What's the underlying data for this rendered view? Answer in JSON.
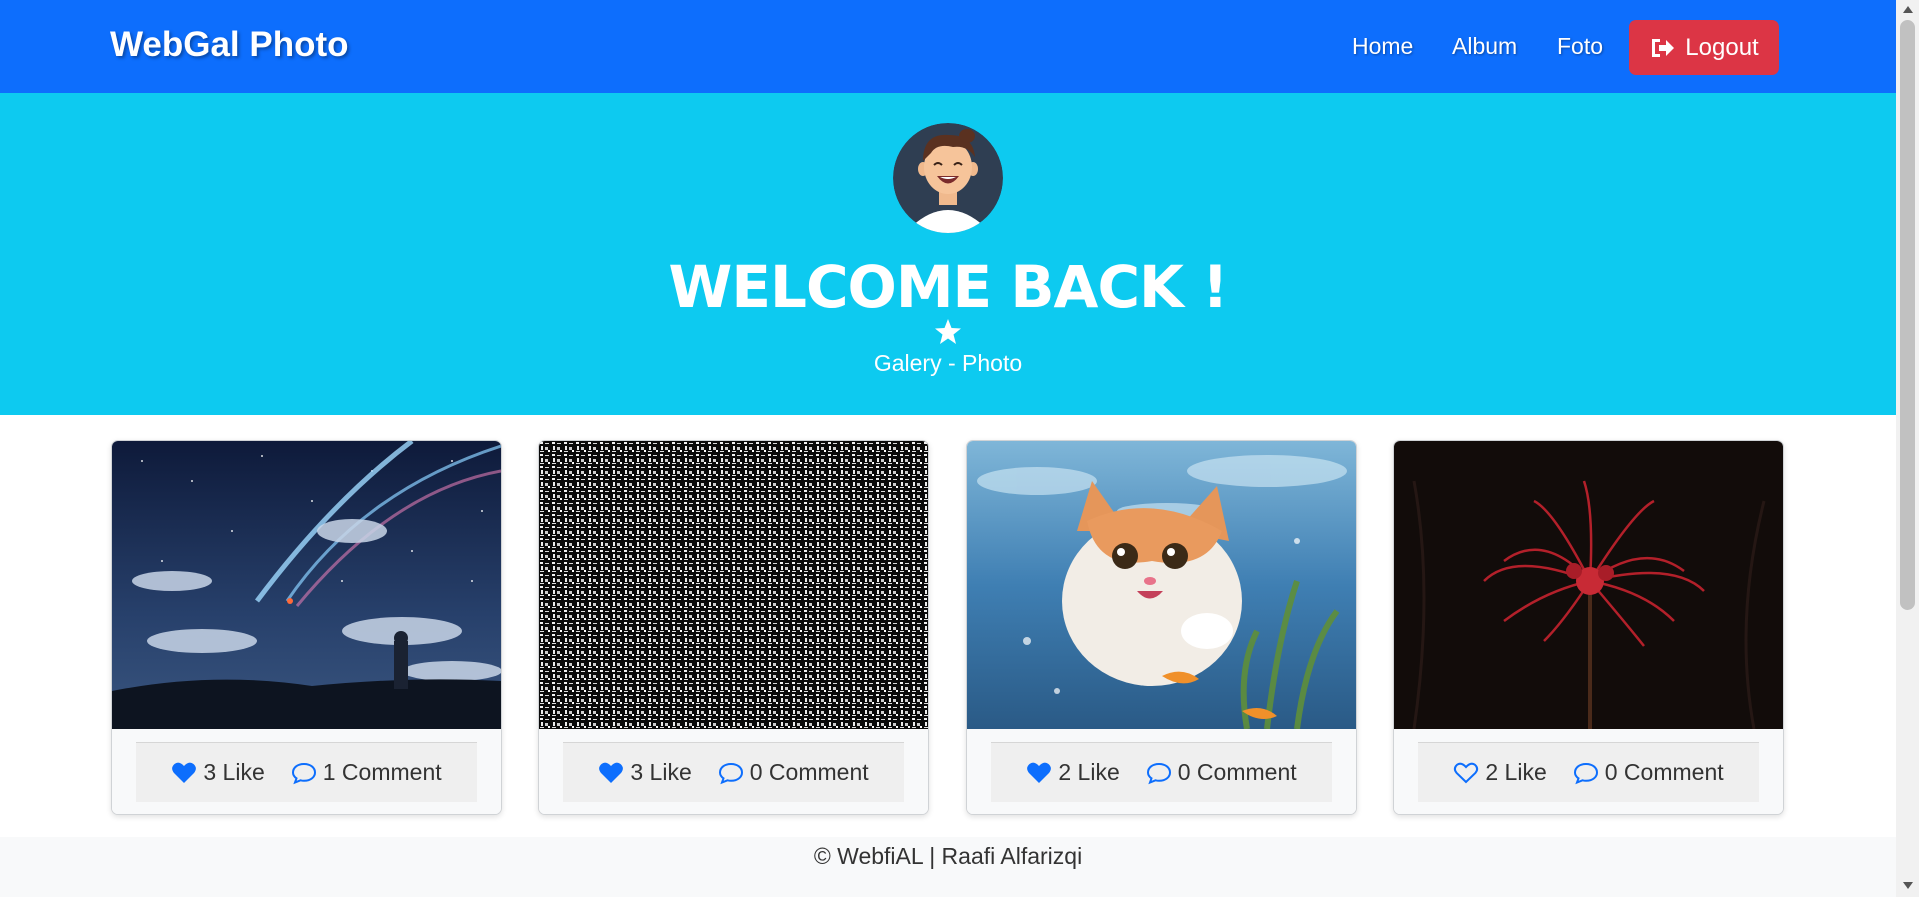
{
  "navbar": {
    "brand": "WebGal Photo",
    "links": [
      "Home",
      "Album",
      "Foto"
    ],
    "logout_label": "Logout",
    "bg_color": "#0d6efd",
    "logout_color": "#dc3545"
  },
  "hero": {
    "title": "WELCOME BACK !",
    "subtitle": "Galery - Photo",
    "bg_color": "#0dcaf0",
    "avatar_icon": "user-avatar",
    "divider_icon": "star-icon"
  },
  "cards": [
    {
      "image": "comet-night-sky",
      "likes": "3 Like",
      "comments": "1 Comment",
      "liked": true
    },
    {
      "image": "matrix-code-pattern",
      "likes": "3 Like",
      "comments": "0 Comment",
      "liked": true
    },
    {
      "image": "kitten-underwater",
      "likes": "2 Like",
      "comments": "0 Comment",
      "liked": true
    },
    {
      "image": "red-spider-lily",
      "likes": "2 Like",
      "comments": "0 Comment",
      "liked": false
    }
  ],
  "footer": {
    "text": "© WebfiAL | Raafi Alfarizqi"
  }
}
